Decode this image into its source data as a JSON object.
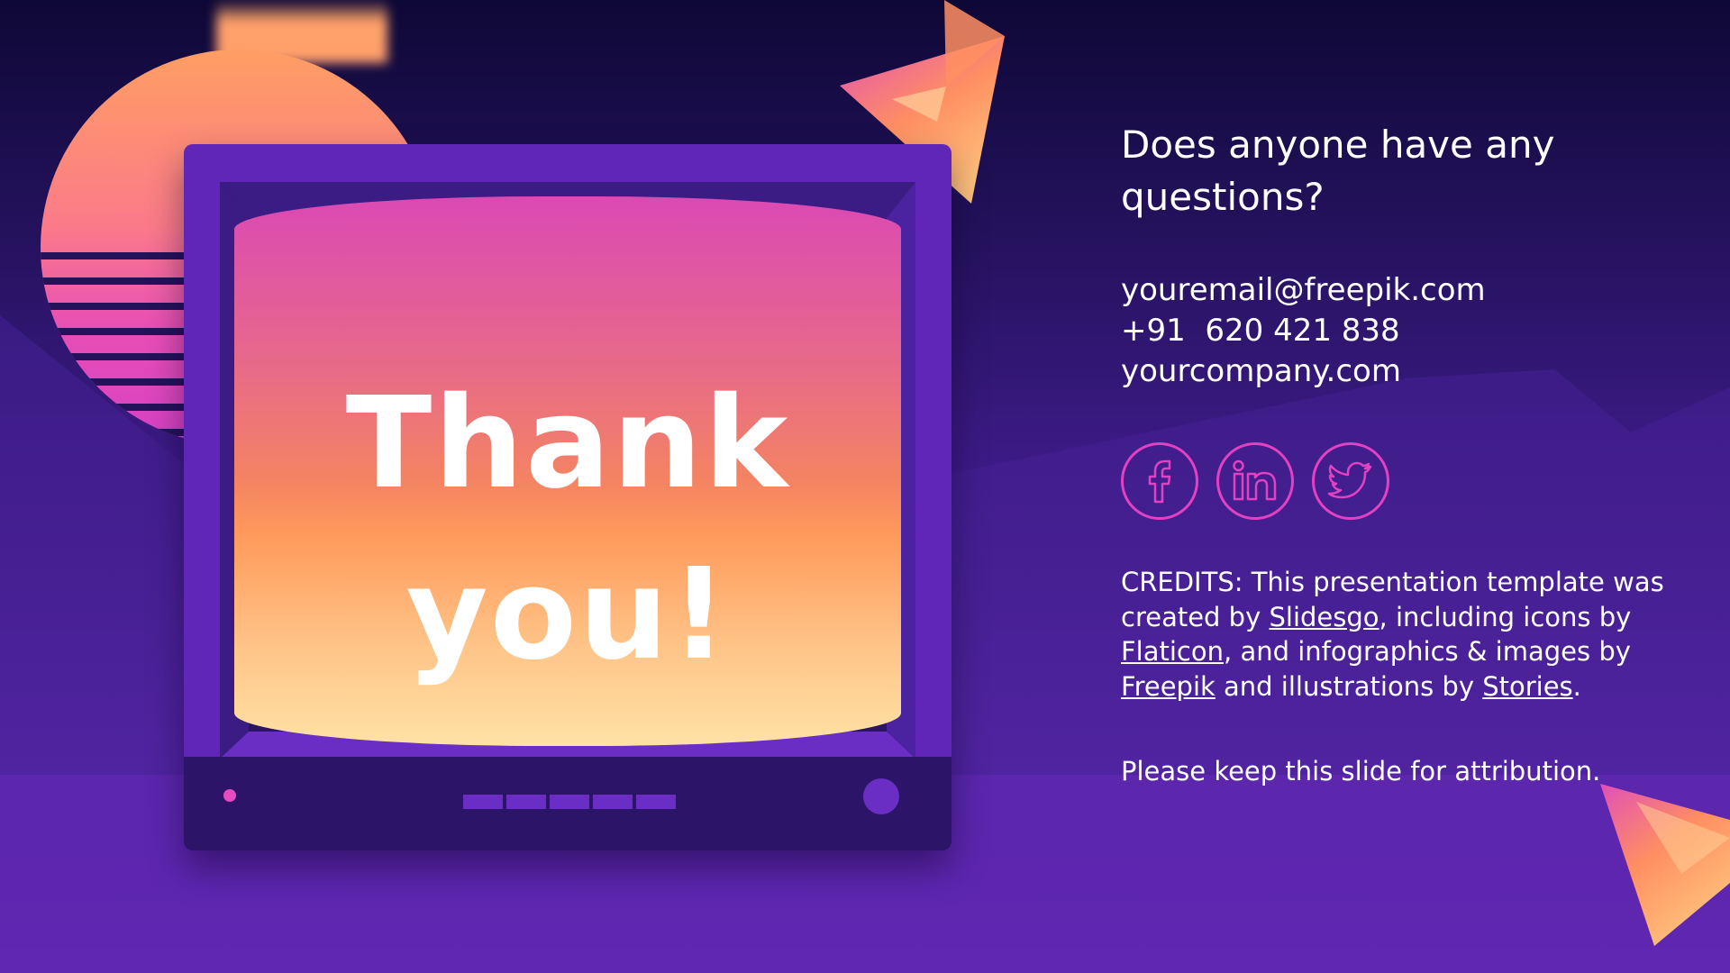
{
  "slide": {
    "screen_title_line1": "Thank",
    "screen_title_line2": "you!",
    "question": "Does anyone have any questions?",
    "contact": {
      "email": "youremail@freepik.com",
      "phone": "+91  620 421 838",
      "website": "yourcompany.com"
    },
    "social_icons": [
      "facebook-icon",
      "linkedin-icon",
      "twitter-icon"
    ],
    "credits": {
      "prefix": "CREDITS: This presentation template was created by ",
      "link1": "Slidesgo",
      "mid1": ", including icons by ",
      "link2": "Flaticon",
      "mid2": ", and infographics & images by ",
      "link3": "Freepik",
      "mid3": " and illustrations by ",
      "link4": "Stories",
      "suffix": "."
    },
    "attribution": "Please keep this slide for attribution."
  },
  "colors": {
    "accent_pink": "#e241c3",
    "background_top": "#0e0836",
    "background_bottom": "#6428b5",
    "tv_body": "#6026b8",
    "screen_top": "#db49b4",
    "screen_bottom": "#ffe2a6"
  }
}
